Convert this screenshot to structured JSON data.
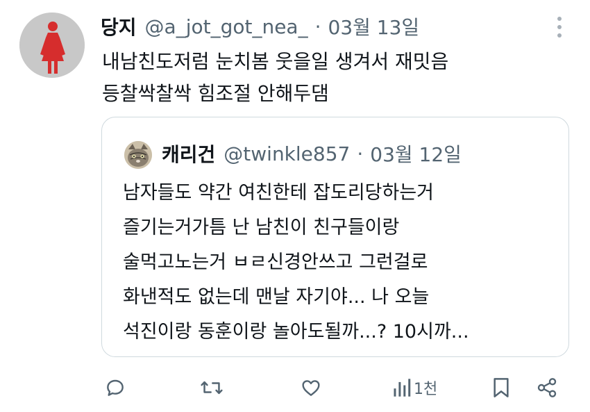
{
  "author": {
    "display_name": "당지",
    "handle": "@a_jot_got_nea_",
    "separator": "·",
    "date": "03월 13일"
  },
  "tweet": {
    "lines": [
      "내남친도저럼 눈치봄 웃을일 생겨서 재밋음",
      "등찰싹찰싹 힘조절 안해두댐"
    ]
  },
  "quote": {
    "display_name": "캐리건",
    "handle": "@twinkle857",
    "separator": "·",
    "date": "03월 12일",
    "lines": [
      "남자들도 약간 여친한테 잡도리당하는거",
      "즐기는거가틈 난 남친이 친구들이랑",
      "술먹고노는거 ㅂㄹ신경안쓰고 그런걸로",
      "화낸적도 없는데 맨날 자기야... 나 오늘",
      "석진이랑 동훈이랑 놀아도될까...? 10시까..."
    ]
  },
  "actions": {
    "views_count": "1천"
  },
  "icons": {
    "reply": "comment-icon",
    "retweet": "retweet-icon",
    "like": "heart-icon",
    "views": "bar-chart-icon",
    "bookmark": "bookmark-icon",
    "share": "share-icon",
    "more": "more-vertical-icon"
  },
  "colors": {
    "text_primary": "#0f1419",
    "text_secondary": "#536471",
    "border": "#cfd9de",
    "avatar_bg": "#c9c9c9",
    "avatar_figure": "#d62d2d"
  }
}
